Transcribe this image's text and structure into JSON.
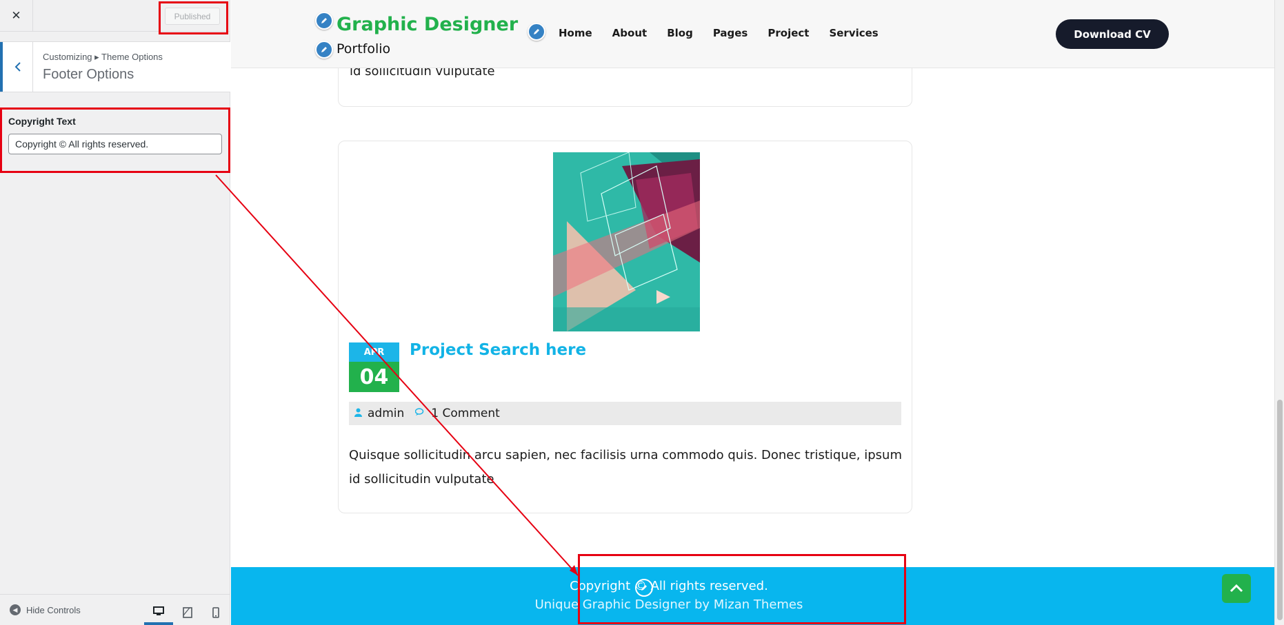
{
  "customizer": {
    "close_label": "✕",
    "publish_button": "Published",
    "breadcrumb": "Customizing ▸ Theme Options",
    "section_title": "Footer Options",
    "back_glyph": "‹",
    "control_label": "Copyright Text",
    "control_value": "Copyright © All rights reserved.",
    "hide_controls": "Hide Controls",
    "devices": [
      "desktop",
      "tablet",
      "mobile"
    ],
    "selected_device": "desktop"
  },
  "site": {
    "title": "Graphic Designer",
    "tagline": "Portfolio",
    "nav": [
      "Home",
      "About",
      "Blog",
      "Pages",
      "Project",
      "Services"
    ],
    "cta": "Download CV",
    "colors": {
      "green": "#22b14c",
      "blue": "#08b6ee",
      "dark": "#161b2b"
    }
  },
  "posts": {
    "prev_excerpt_tail": "id sollicitudin vulputate",
    "current": {
      "month": "APR",
      "day": "04",
      "title": "Project Search here",
      "author": "admin",
      "comments": "1 Comment",
      "excerpt": "Quisque sollicitudin arcu sapien, nec facilisis urna commodo quis. Donec tristique, ipsum id sollicitudin vulputate"
    }
  },
  "footer": {
    "copyright": "Copyright © All rights reserved.",
    "credit": "Unique Graphic Designer by Mizan Themes"
  },
  "icons": [
    "close-icon",
    "chevron-left-icon",
    "pencil-icon",
    "user-icon",
    "comments-icon",
    "chevron-up-icon",
    "desktop-icon",
    "tablet-icon",
    "mobile-icon",
    "arrow-left-circle-icon"
  ]
}
